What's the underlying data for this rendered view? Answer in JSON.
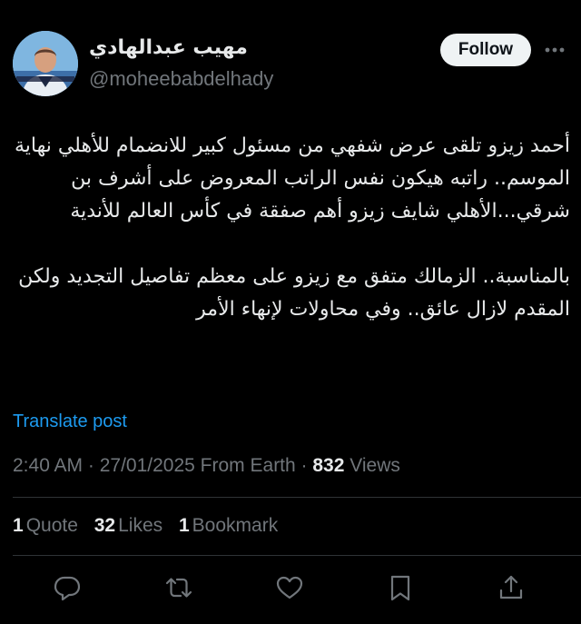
{
  "author": {
    "display_name": "مهيب عبدالهادي",
    "handle": "@moheebabdelhady",
    "avatar_icon": "user-avatar-photo"
  },
  "header": {
    "follow_label": "Follow",
    "more_icon": "more-horizontal-icon"
  },
  "post": {
    "paragraphs": [
      "أحمد زيزو تلقى عرض شفهي من مسئول كبير للانضمام للأهلي نهاية الموسم.. راتبه هيكون نفس الراتب المعروض على أشرف بن شرقي...الأهلي شايف زيزو أهم صفقة في كأس العالم للأندية",
      "بالمناسبة.. الزمالك متفق مع زيزو على معظم تفاصيل التجديد ولكن المقدم لازال عائق.. وفي محاولات لإنهاء الأمر"
    ],
    "translate_label": "Translate post"
  },
  "meta": {
    "time": "2:40 AM",
    "sep1": " · ",
    "date": "27/01/2025",
    "source": " From Earth",
    "sep2": " · ",
    "views_count": "832",
    "views_label": " Views"
  },
  "stats": {
    "quotes_count": "1",
    "quotes_label": "Quote",
    "likes_count": "32",
    "likes_label": "Likes",
    "bookmarks_count": "1",
    "bookmarks_label": "Bookmark"
  },
  "actions": {
    "icons": [
      "reply-icon",
      "repost-icon",
      "like-icon",
      "bookmark-icon",
      "share-icon"
    ]
  },
  "colors": {
    "background": "#000000",
    "text": "#e7e9ea",
    "secondary": "#71767b",
    "link": "#1d9bf0",
    "divider": "#2f3336",
    "follow_bg": "#eff3f4"
  }
}
